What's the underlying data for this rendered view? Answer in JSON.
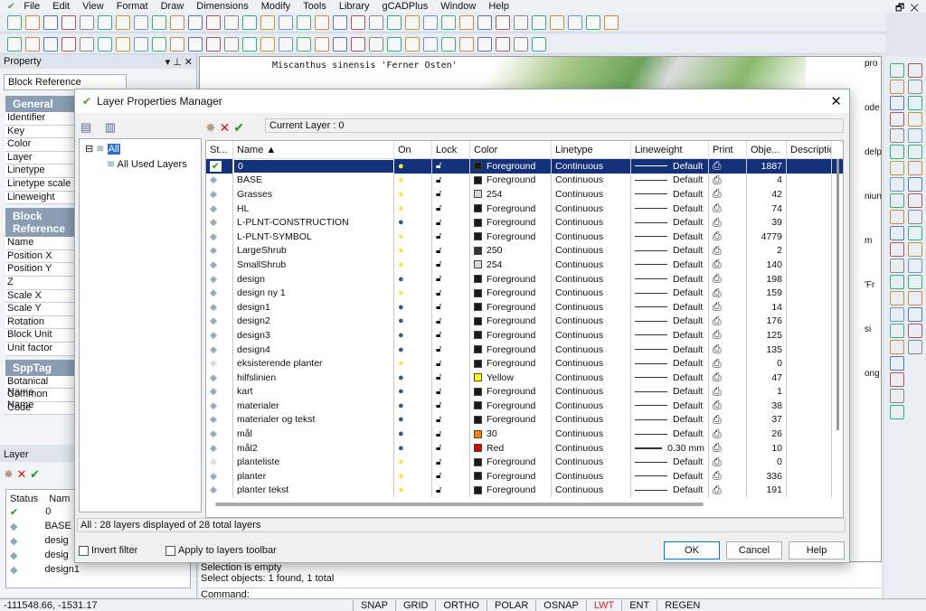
{
  "menu": [
    "File",
    "Edit",
    "View",
    "Format",
    "Draw",
    "Dimensions",
    "Modify",
    "Tools",
    "Library",
    "gCADPlus",
    "Window",
    "Help"
  ],
  "window_controls": {
    "restore": "🗗",
    "close": "✕"
  },
  "drawing_text": {
    "label": "Miscanthus sinensis 'Ferner Osten'",
    "fragments": [
      "pro",
      "ode",
      "delp",
      "niun",
      "m",
      "'Fr",
      "si",
      "ong"
    ]
  },
  "property": {
    "title": "Property",
    "selector": "Block Reference",
    "sections": [
      {
        "title": "General",
        "rows": [
          "Identifier",
          "Key",
          "Color",
          "Layer",
          "Linetype",
          "Linetype scale",
          "Lineweight"
        ]
      },
      {
        "title": "Block Reference",
        "rows": [
          "Name",
          "Position X",
          "Position Y",
          "Z",
          "Scale X",
          "Scale Y",
          "Rotation",
          "Block Unit",
          "Unit factor"
        ]
      },
      {
        "title": "SppTag",
        "rows": [
          "Botanical Name",
          "Common Name",
          "Code"
        ]
      }
    ]
  },
  "layer_panel": {
    "title": "Layer",
    "col_status": "Status",
    "col_name": "Nam",
    "rows": [
      "0",
      "BASE",
      "desig",
      "desig",
      "design1"
    ]
  },
  "command": {
    "lines": [
      "Selection is empty",
      "Select objects: 1 found,  1 total"
    ],
    "prompt": "Command:"
  },
  "status": {
    "coords": "-111548.66, -1531.17",
    "buttons": [
      "SNAP",
      "GRID",
      "ORTHO",
      "POLAR",
      "OSNAP",
      "LWT",
      "ENT",
      "REGEN"
    ],
    "active": "LWT"
  },
  "dialog": {
    "title": "Layer Properties Manager",
    "current_layer": "Current Layer : 0",
    "tree": {
      "root": "All",
      "child": "All Used Layers"
    },
    "columns": [
      "St...",
      "Name  ▲",
      "On",
      "Lock",
      "Color",
      "Linetype",
      "Lineweight",
      "Print",
      "Obje...",
      "Descriptio"
    ],
    "rows": [
      {
        "name": "0",
        "on": true,
        "color": "Foreground",
        "swatch": "#1a1a1a",
        "lt": "Continuous",
        "lw": "Default",
        "objects": "1887",
        "current": true
      },
      {
        "name": "BASE",
        "on": true,
        "color": "Foreground",
        "swatch": "#1a1a1a",
        "lt": "Continuous",
        "lw": "Default",
        "objects": "4"
      },
      {
        "name": "Grasses",
        "on": true,
        "color": "254",
        "swatch": "#d8d8d8",
        "lt": "Continuous",
        "lw": "Default",
        "objects": "42"
      },
      {
        "name": "HL",
        "on": true,
        "color": "Foreground",
        "swatch": "#1a1a1a",
        "lt": "Continuous",
        "lw": "Default",
        "objects": "74"
      },
      {
        "name": "L-PLNT-CONSTRUCTION",
        "on": false,
        "color": "Foreground",
        "swatch": "#1a1a1a",
        "lt": "Continuous",
        "lw": "Default",
        "objects": "39"
      },
      {
        "name": "L-PLNT-SYMBOL",
        "on": true,
        "color": "Foreground",
        "swatch": "#1a1a1a",
        "lt": "Continuous",
        "lw": "Default",
        "objects": "4779"
      },
      {
        "name": "LargeShrub",
        "on": true,
        "color": "250",
        "swatch": "#333333",
        "lt": "Continuous",
        "lw": "Default",
        "objects": "2"
      },
      {
        "name": "SmallShrub",
        "on": true,
        "color": "254",
        "swatch": "#d8d8d8",
        "lt": "Continuous",
        "lw": "Default",
        "objects": "140"
      },
      {
        "name": "design",
        "on": false,
        "color": "Foreground",
        "swatch": "#1a1a1a",
        "lt": "Continuous",
        "lw": "Default",
        "objects": "198"
      },
      {
        "name": "design ny 1",
        "on": true,
        "color": "Foreground",
        "swatch": "#1a1a1a",
        "lt": "Continuous",
        "lw": "Default",
        "objects": "159"
      },
      {
        "name": "design1",
        "on": false,
        "color": "Foreground",
        "swatch": "#1a1a1a",
        "lt": "Continuous",
        "lw": "Default",
        "objects": "14"
      },
      {
        "name": "design2",
        "on": false,
        "color": "Foreground",
        "swatch": "#1a1a1a",
        "lt": "Continuous",
        "lw": "Default",
        "objects": "176"
      },
      {
        "name": "design3",
        "on": false,
        "color": "Foreground",
        "swatch": "#1a1a1a",
        "lt": "Continuous",
        "lw": "Default",
        "objects": "125"
      },
      {
        "name": "design4",
        "on": false,
        "color": "Foreground",
        "swatch": "#1a1a1a",
        "lt": "Continuous",
        "lw": "Default",
        "objects": "135"
      },
      {
        "name": "eksisterende planter",
        "on": true,
        "color": "Foreground",
        "swatch": "#1a1a1a",
        "lt": "Continuous",
        "lw": "Default",
        "objects": "0",
        "empty": true
      },
      {
        "name": "hilfslinien",
        "on": false,
        "color": "Yellow",
        "swatch": "#ffff00",
        "lt": "Continuous",
        "lw": "Default",
        "objects": "47"
      },
      {
        "name": "kart",
        "on": false,
        "color": "Foreground",
        "swatch": "#1a1a1a",
        "lt": "Continuous",
        "lw": "Default",
        "objects": "1"
      },
      {
        "name": "materialer",
        "on": false,
        "color": "Foreground",
        "swatch": "#1a1a1a",
        "lt": "Continuous",
        "lw": "Default",
        "objects": "38"
      },
      {
        "name": "materialer og tekst",
        "on": false,
        "color": "Foreground",
        "swatch": "#1a1a1a",
        "lt": "Continuous",
        "lw": "Default",
        "objects": "37"
      },
      {
        "name": "mål",
        "on": false,
        "color": "30",
        "swatch": "#ff7f00",
        "lt": "Continuous",
        "lw": "Default",
        "objects": "26"
      },
      {
        "name": "mål2",
        "on": false,
        "color": "Red",
        "swatch": "#e00000",
        "lt": "Continuous",
        "lw": "0.30 mm",
        "objects": "10",
        "thick": true
      },
      {
        "name": "planteliste",
        "on": true,
        "color": "Foreground",
        "swatch": "#1a1a1a",
        "lt": "Continuous",
        "lw": "Default",
        "objects": "0",
        "empty": true
      },
      {
        "name": "planter",
        "on": true,
        "color": "Foreground",
        "swatch": "#1a1a1a",
        "lt": "Continuous",
        "lw": "Default",
        "objects": "336"
      },
      {
        "name": "planter tekst",
        "on": true,
        "color": "Foreground",
        "swatch": "#1a1a1a",
        "lt": "Continuous",
        "lw": "Default",
        "objects": "191"
      }
    ],
    "summary": "All : 28 layers displayed of 28 total layers",
    "invert_filter": "Invert filter",
    "apply_toolbar": "Apply to layers toolbar",
    "ok": "OK",
    "cancel": "Cancel",
    "help": "Help"
  },
  "colors": {
    "selection": "#14327a",
    "bulb_on": "#f5e84a",
    "bulb_off": "#2f5f86",
    "check": "#1a9a1a",
    "delete": "#d11"
  }
}
